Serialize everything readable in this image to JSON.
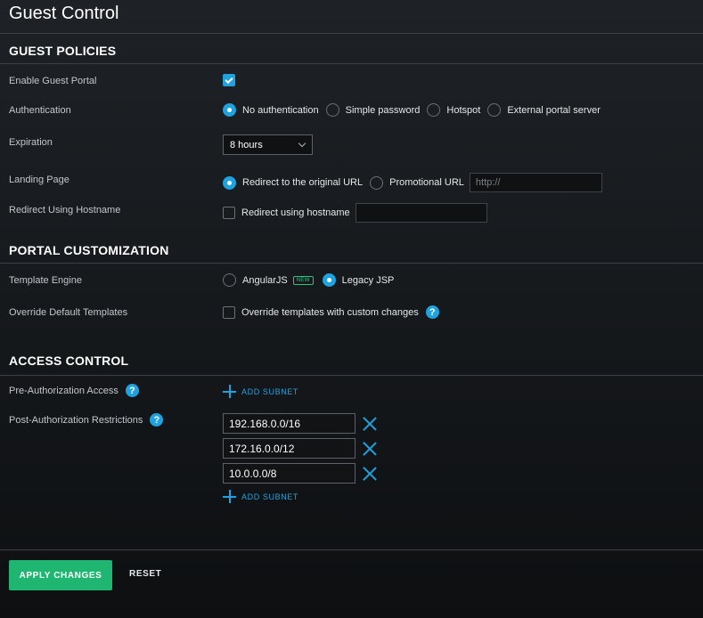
{
  "page": {
    "title": "Guest Control"
  },
  "guest_policies": {
    "heading": "GUEST POLICIES",
    "enable_portal": {
      "label": "Enable Guest Portal",
      "checked": true
    },
    "authentication": {
      "label": "Authentication",
      "options": [
        "No authentication",
        "Simple password",
        "Hotspot",
        "External portal server"
      ],
      "selected": "No authentication"
    },
    "expiration": {
      "label": "Expiration",
      "value": "8 hours"
    },
    "landing_page": {
      "label": "Landing Page",
      "options": [
        "Redirect to the original URL",
        "Promotional URL"
      ],
      "selected": "Redirect to the original URL",
      "url_placeholder": "http://"
    },
    "redirect_hostname": {
      "label": "Redirect Using Hostname",
      "checkbox_label": "Redirect using hostname",
      "checked": false,
      "value": ""
    }
  },
  "portal_customization": {
    "heading": "PORTAL CUSTOMIZATION",
    "template_engine": {
      "label": "Template Engine",
      "options": [
        "AngularJS",
        "Legacy JSP"
      ],
      "new_badge": "NEW",
      "selected": "Legacy JSP"
    },
    "override_templates": {
      "label": "Override Default Templates",
      "checkbox_label": "Override templates with custom changes",
      "checked": false
    }
  },
  "access_control": {
    "heading": "ACCESS CONTROL",
    "pre_auth": {
      "label": "Pre-Authorization Access",
      "add_label": "ADD SUBNET"
    },
    "post_auth": {
      "label": "Post-Authorization Restrictions",
      "subnets": [
        "192.168.0.0/16",
        "172.16.0.0/12",
        "10.0.0.0/8"
      ],
      "add_label": "ADD SUBNET"
    }
  },
  "footer": {
    "apply_label": "APPLY CHANGES",
    "reset_label": "RESET"
  },
  "colors": {
    "accent": "#1fa3e0",
    "apply": "#1fb672",
    "new_badge": "#2fc283"
  },
  "icons": {
    "help": "?"
  }
}
